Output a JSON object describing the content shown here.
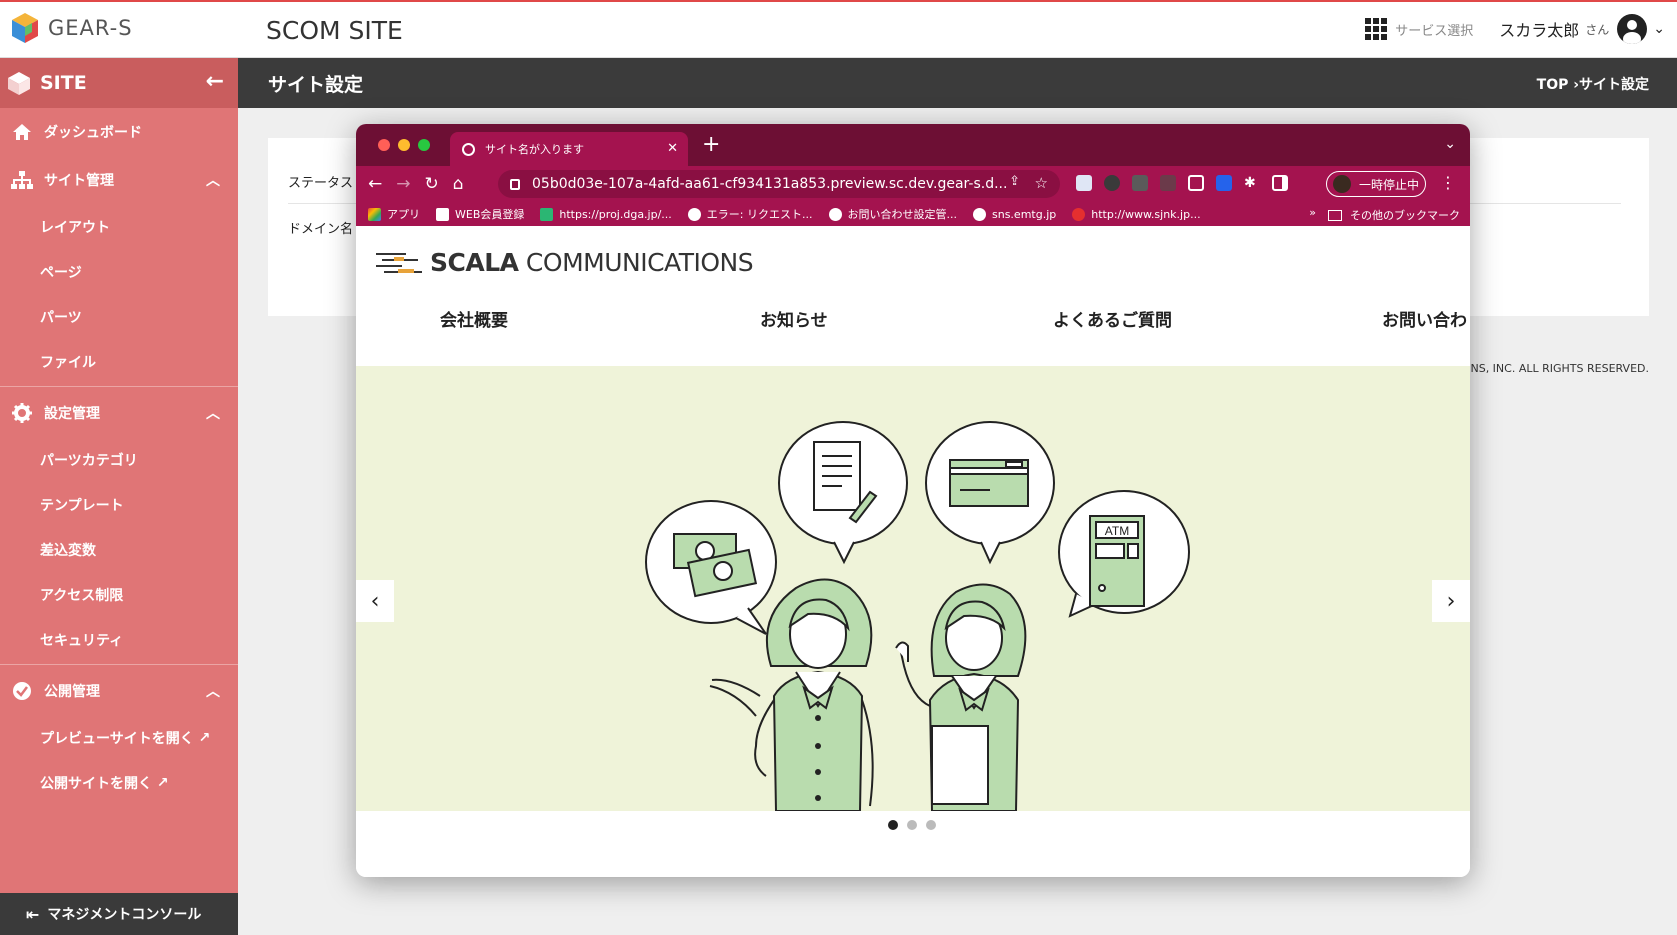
{
  "app": {
    "logo_text": "GEAR-S",
    "site_title": "SCOM SITE",
    "service_select": "サービス選択",
    "user_name": "スカラ太郎",
    "user_suffix": "さん"
  },
  "sidebar": {
    "header": "SITE",
    "dashboard": "ダッシュボード",
    "site_mgmt": {
      "label": "サイト管理",
      "items": [
        "レイアウト",
        "ページ",
        "パーツ",
        "ファイル"
      ]
    },
    "settings_mgmt": {
      "label": "設定管理",
      "items": [
        "パーツカテゴリ",
        "テンプレート",
        "差込変数",
        "アクセス制限",
        "セキュリティ"
      ]
    },
    "publish_mgmt": {
      "label": "公開管理",
      "items": [
        "プレビューサイトを開く",
        "公開サイトを開く"
      ]
    },
    "footer": "マネジメントコンソール"
  },
  "page": {
    "title": "サイト設定",
    "breadcrumb": "TOP ›サイト設定",
    "field_status": "ステータス",
    "field_domain": "ドメイン名",
    "copyright": "TIONS, INC. ALL RIGHTS RESERVED."
  },
  "browser": {
    "tab_title": "サイト名が入ります",
    "url": "05b0d03e-107a-4afd-aa61-cf934131a853.preview.sc.dev.gear-s.d...",
    "paused": "一時停止中",
    "bookmarks": [
      "アプリ",
      "WEB会員登録",
      "https://proj.dga.jp/...",
      "エラー: リクエスト...",
      "お問い合わせ設定管...",
      "sns.emtg.jp",
      "http://www.sjnk.jp..."
    ],
    "bookmarks_more": "»",
    "bookmarks_other": "その他のブックマーク"
  },
  "preview": {
    "brand_bold": "SCALA",
    "brand_rest": " COMMUNICATIONS",
    "nav": [
      "会社概要",
      "お知らせ",
      "よくあるご質問",
      "お問い合わ"
    ],
    "atm_label": "ATM",
    "slide_count": 3,
    "active_slide": 1
  },
  "colors": {
    "sidebar": "#e07576",
    "browser_chrome": "#a4134f",
    "hero_bg": "#eff3d9",
    "illustration_green": "#b9dcae"
  }
}
